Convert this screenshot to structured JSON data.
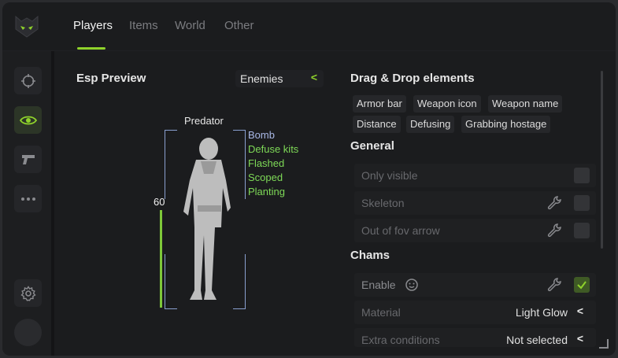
{
  "nav": {
    "tabs": [
      {
        "label": "Players",
        "active": true
      },
      {
        "label": "Items",
        "active": false
      },
      {
        "label": "World",
        "active": false
      },
      {
        "label": "Other",
        "active": false
      }
    ]
  },
  "sidebar": {
    "items": [
      {
        "icon": "crosshair-icon",
        "active": false
      },
      {
        "icon": "eye-icon",
        "active": true
      },
      {
        "icon": "pistol-icon",
        "active": false
      },
      {
        "icon": "more-dots-icon",
        "active": false
      }
    ],
    "bottom_items": [
      {
        "icon": "gear-icon"
      },
      {
        "icon": "avatar"
      }
    ]
  },
  "esp_preview": {
    "title": "Esp Preview",
    "dropdown_value": "Enemies",
    "dropdown_arrow": "<",
    "player_name": "Predator",
    "health_value": "60",
    "health_fraction": 0.6,
    "flags": [
      {
        "text": "Bomb",
        "color": "#a9b8e6"
      },
      {
        "text": "Defuse kits",
        "color": "#7ed957"
      },
      {
        "text": "Flashed",
        "color": "#7ed957"
      },
      {
        "text": "Scoped",
        "color": "#7ed957"
      },
      {
        "text": "Planting",
        "color": "#7ed957"
      }
    ]
  },
  "drag_drop": {
    "title": "Drag & Drop elements",
    "chips": [
      "Armor bar",
      "Weapon icon",
      "Weapon name",
      "Distance",
      "Defusing",
      "Grabbing hostage"
    ]
  },
  "general": {
    "title": "General",
    "rows": [
      {
        "label": "Only visible",
        "has_wrench": false,
        "checked": false
      },
      {
        "label": "Skeleton",
        "has_wrench": true,
        "checked": false
      },
      {
        "label": "Out of fov arrow",
        "has_wrench": true,
        "checked": false
      }
    ]
  },
  "chams": {
    "title": "Chams",
    "enable": {
      "label": "Enable",
      "has_wrench": true,
      "checked": true
    },
    "material": {
      "label": "Material",
      "value": "Light Glow",
      "arrow": "<"
    },
    "extra": {
      "label": "Extra conditions",
      "value": "Not selected",
      "arrow": "<"
    }
  },
  "colors": {
    "accent": "#8fd22b",
    "background": "#1b1c1e",
    "row_bg": "#1f2022",
    "box_outline": "#8aa0d0"
  }
}
